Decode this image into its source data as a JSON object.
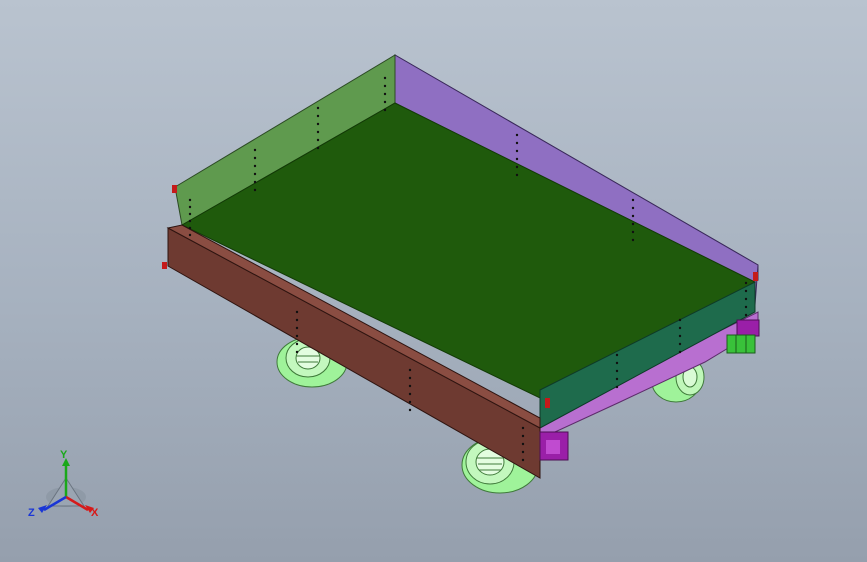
{
  "viewport": {
    "background_top": "#b9c3cf",
    "background_bottom": "#959fad"
  },
  "model": {
    "parts": [
      {
        "name": "floor-panel",
        "color": "#1f5a0c"
      },
      {
        "name": "left-side-panel",
        "color": "#5f9a4e"
      },
      {
        "name": "rear-side-panel",
        "color": "#8f6fc2"
      },
      {
        "name": "front-side-panel",
        "color": "#6e3a31"
      },
      {
        "name": "right-side-panel",
        "color": "#1e6b4c"
      },
      {
        "name": "chassis-frame",
        "color": "#b86fd0"
      },
      {
        "name": "wheels",
        "color": "#9ff39a"
      },
      {
        "name": "brackets",
        "color": "#9a1fa8"
      },
      {
        "name": "rear-bracket",
        "color": "#39c23a"
      }
    ]
  },
  "triad": {
    "x_label": "X",
    "y_label": "Y",
    "z_label": "Z",
    "x_color": "#d61a1a",
    "y_color": "#1aa81a",
    "z_color": "#1a36d6"
  }
}
